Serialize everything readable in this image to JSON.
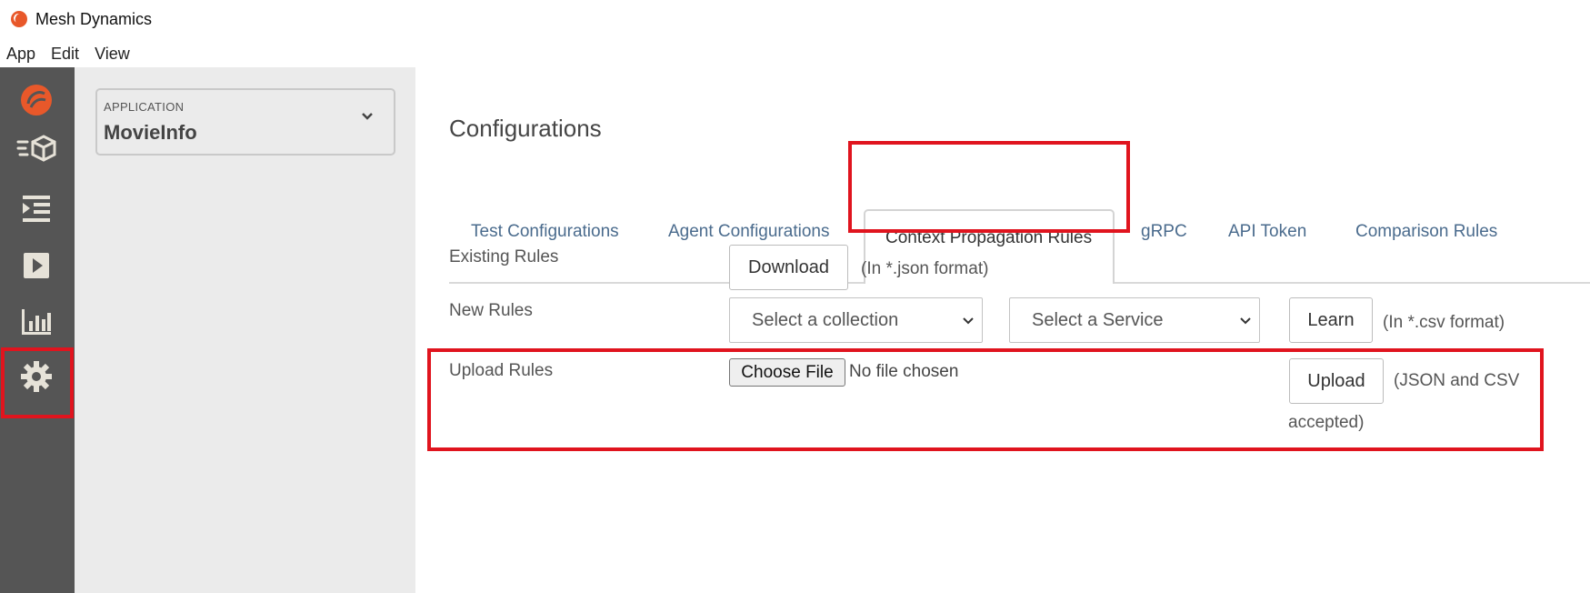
{
  "window": {
    "title": "Mesh Dynamics"
  },
  "menu": [
    "App",
    "Edit",
    "View"
  ],
  "sidebar": {
    "icons": [
      "mesh-logo-icon",
      "api-catalog-icon",
      "test-list-icon",
      "play-icon",
      "bar-chart-icon",
      "gear-icon"
    ],
    "active": "gear-icon"
  },
  "application": {
    "label": "APPLICATION",
    "value": "MovieInfo"
  },
  "page": {
    "title": "Configurations"
  },
  "tabs": [
    {
      "label": "Test Configurations"
    },
    {
      "label": "Agent Configurations"
    },
    {
      "label": "Context Propagation Rules",
      "active": true
    },
    {
      "label": "gRPC"
    },
    {
      "label": "API Token"
    },
    {
      "label": "Comparison Rules"
    }
  ],
  "existing_rules": {
    "label": "Existing Rules",
    "button": "Download",
    "note": "(In *.json format)"
  },
  "new_rules": {
    "label": "New Rules",
    "collection_select": "Select a collection",
    "service_select": "Select a Service",
    "button": "Learn",
    "note": "(In *.csv format)"
  },
  "upload_rules": {
    "label": "Upload Rules",
    "file_button": "Choose File",
    "file_status": "No file chosen",
    "button": "Upload",
    "note_line1": "(JSON and CSV",
    "note_line2": "accepted)"
  },
  "colors": {
    "highlight": "#e0141e",
    "rail": "#555555",
    "accent": "#e8582a",
    "tab_link": "#4a6b8d"
  }
}
